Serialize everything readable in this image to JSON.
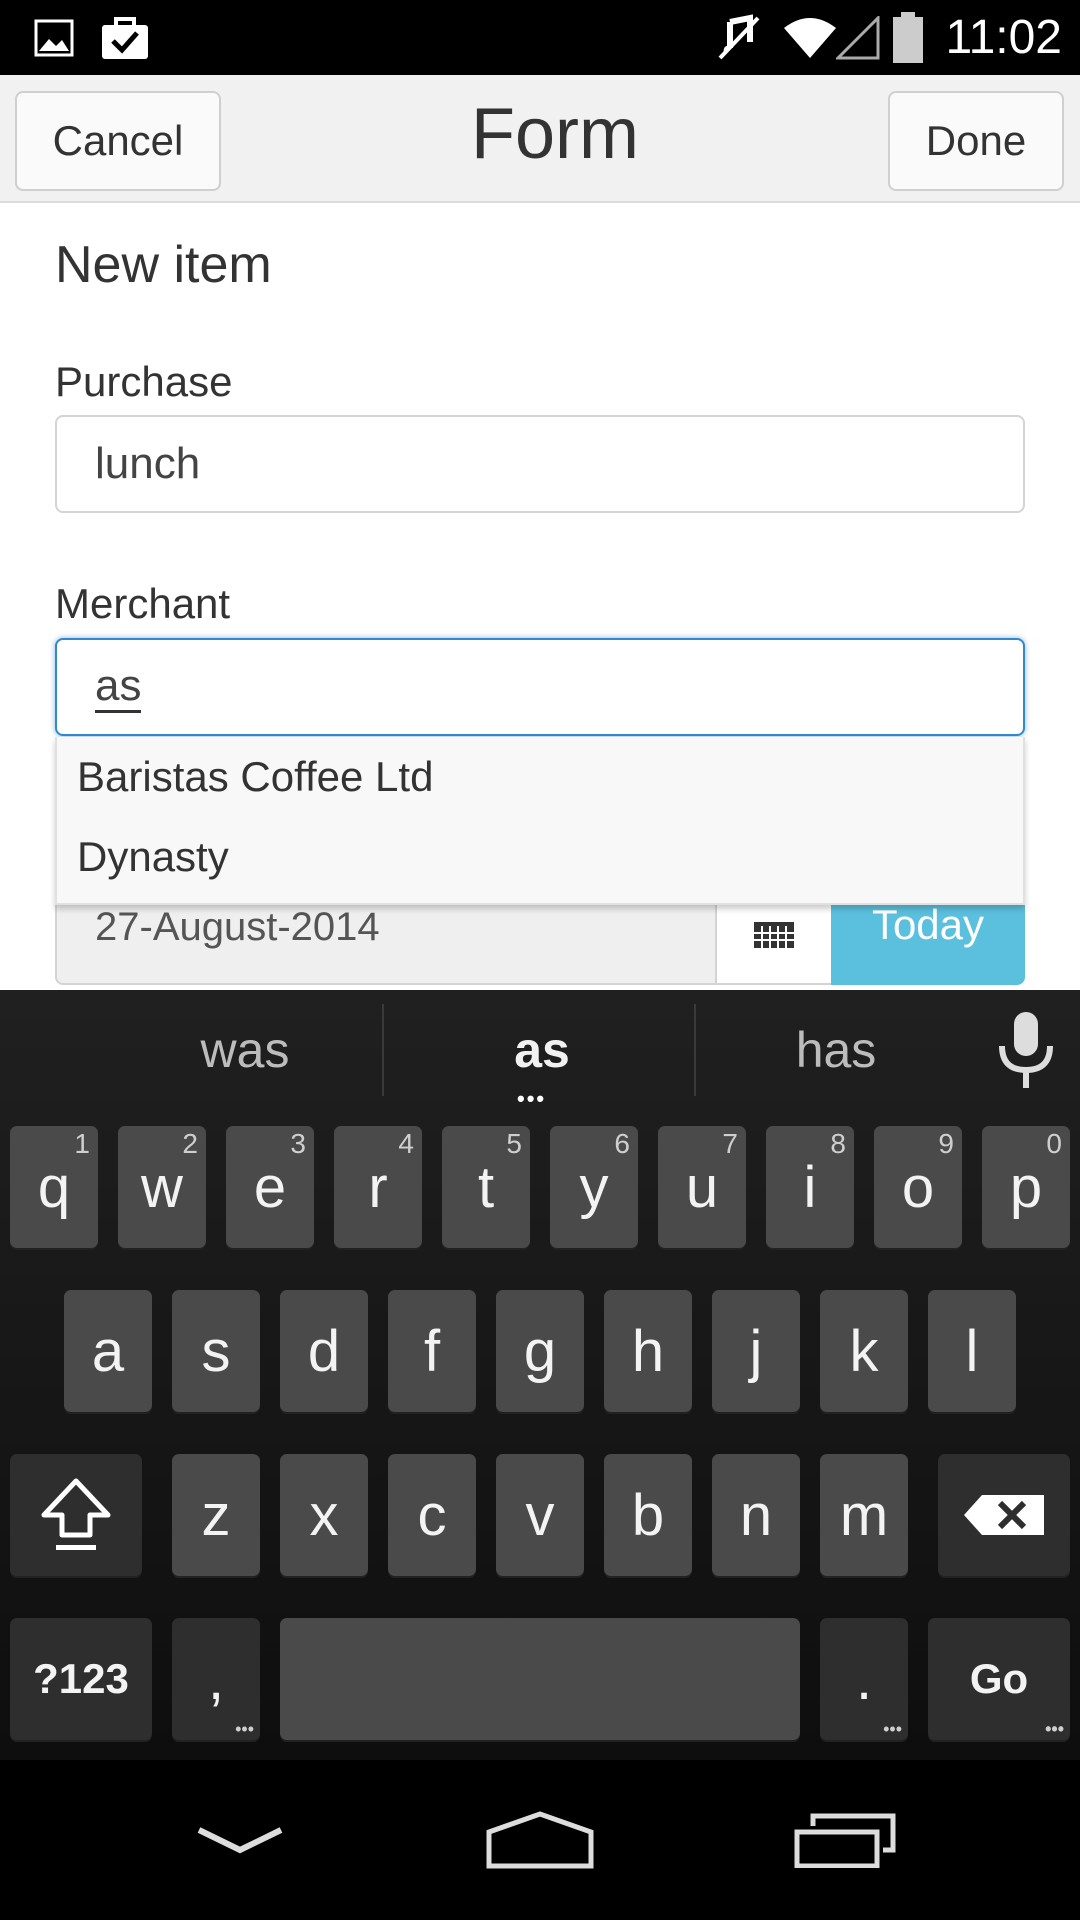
{
  "status_bar": {
    "time": "11:02",
    "icons": [
      "image-icon",
      "clipboard-check-icon",
      "mute-icon",
      "wifi-icon",
      "cell-signal-icon",
      "battery-icon"
    ]
  },
  "header": {
    "title": "Form",
    "cancel_label": "Cancel",
    "done_label": "Done"
  },
  "form": {
    "section_title": "New item",
    "purchase": {
      "label": "Purchase",
      "value": "lunch"
    },
    "merchant": {
      "label": "Merchant",
      "value": "as"
    },
    "autocomplete": [
      "Baristas Coffee Ltd",
      "Dynasty"
    ],
    "date": {
      "value": "27-August-2014",
      "today_label": "Today"
    }
  },
  "keyboard": {
    "suggestions": [
      "was",
      "as",
      "has"
    ],
    "row1": [
      {
        "label": "q",
        "hint": "1"
      },
      {
        "label": "w",
        "hint": "2"
      },
      {
        "label": "e",
        "hint": "3"
      },
      {
        "label": "r",
        "hint": "4"
      },
      {
        "label": "t",
        "hint": "5"
      },
      {
        "label": "y",
        "hint": "6"
      },
      {
        "label": "u",
        "hint": "7"
      },
      {
        "label": "i",
        "hint": "8"
      },
      {
        "label": "o",
        "hint": "9"
      },
      {
        "label": "p",
        "hint": "0"
      }
    ],
    "row2": [
      "a",
      "s",
      "d",
      "f",
      "g",
      "h",
      "j",
      "k",
      "l"
    ],
    "row3": [
      "z",
      "x",
      "c",
      "v",
      "b",
      "n",
      "m"
    ],
    "symbols_label": "?123",
    "comma_label": ",",
    "period_label": ".",
    "go_label": "Go"
  },
  "colors": {
    "focus_border": "#3388cc",
    "today_button": "#5bc0de",
    "key_bg": "#4a4a4a"
  }
}
